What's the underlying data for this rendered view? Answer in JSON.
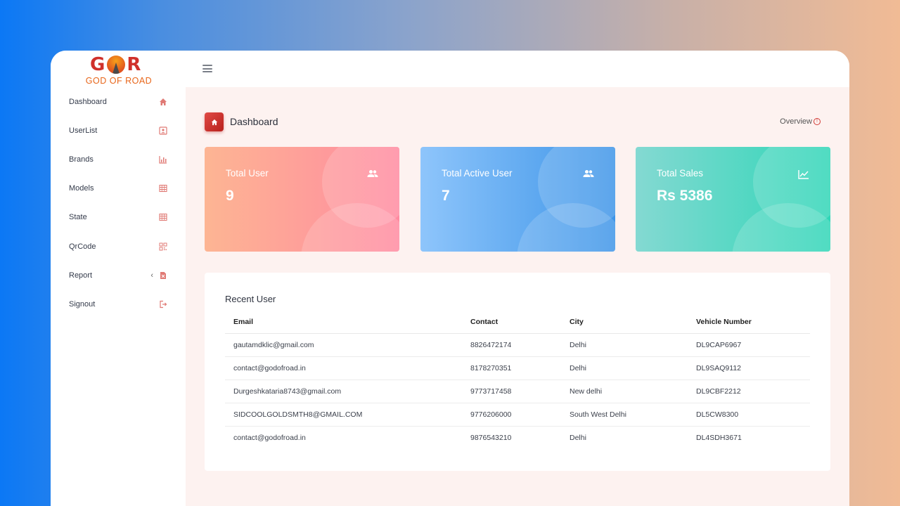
{
  "logo": {
    "top_text": "GOR",
    "letters": [
      "G",
      "R"
    ],
    "bottom_text": "GOD OF ROAD"
  },
  "sidebar": {
    "items": [
      {
        "label": "Dashboard",
        "icon": "home-icon"
      },
      {
        "label": "UserList",
        "icon": "contacts-icon"
      },
      {
        "label": "Brands",
        "icon": "bar-chart-icon"
      },
      {
        "label": "Models",
        "icon": "table-icon"
      },
      {
        "label": "State",
        "icon": "table-icon"
      },
      {
        "label": "QrCode",
        "icon": "qrcode-icon"
      },
      {
        "label": "Report",
        "icon": "report-file-icon",
        "chevron": "‹"
      },
      {
        "label": "Signout",
        "icon": "signout-icon"
      }
    ]
  },
  "header": {
    "title": "Dashboard",
    "overview": "Overview"
  },
  "cards": [
    {
      "title": "Total User",
      "value": "9",
      "icon": "users-icon"
    },
    {
      "title": "Total Active User",
      "value": "7",
      "icon": "users-icon"
    },
    {
      "title": "Total Sales",
      "value": "Rs 5386",
      "icon": "line-chart-icon"
    }
  ],
  "recent": {
    "title": "Recent User",
    "columns": [
      "Email",
      "Contact",
      "City",
      "Vehicle Number"
    ],
    "rows": [
      [
        "gautamdklic@gmail.com",
        "8826472174",
        "Delhi",
        "DL9CAP6967"
      ],
      [
        "contact@godofroad.in",
        "8178270351",
        "Delhi",
        "DL9SAQ9112"
      ],
      [
        "Durgeshkataria8743@gmail.com",
        "9773717458",
        "New delhi",
        "DL9CBF2212"
      ],
      [
        "SIDCOOLGOLDSMTH8@GMAIL.COM",
        "9776206000",
        "South West Delhi",
        "DL5CW8300"
      ],
      [
        "contact@godofroad.in",
        "9876543210",
        "Delhi",
        "DL4SDH3671"
      ]
    ]
  },
  "colors": {
    "accent": "#d23a35",
    "main_bg": "#fdf2f0"
  }
}
